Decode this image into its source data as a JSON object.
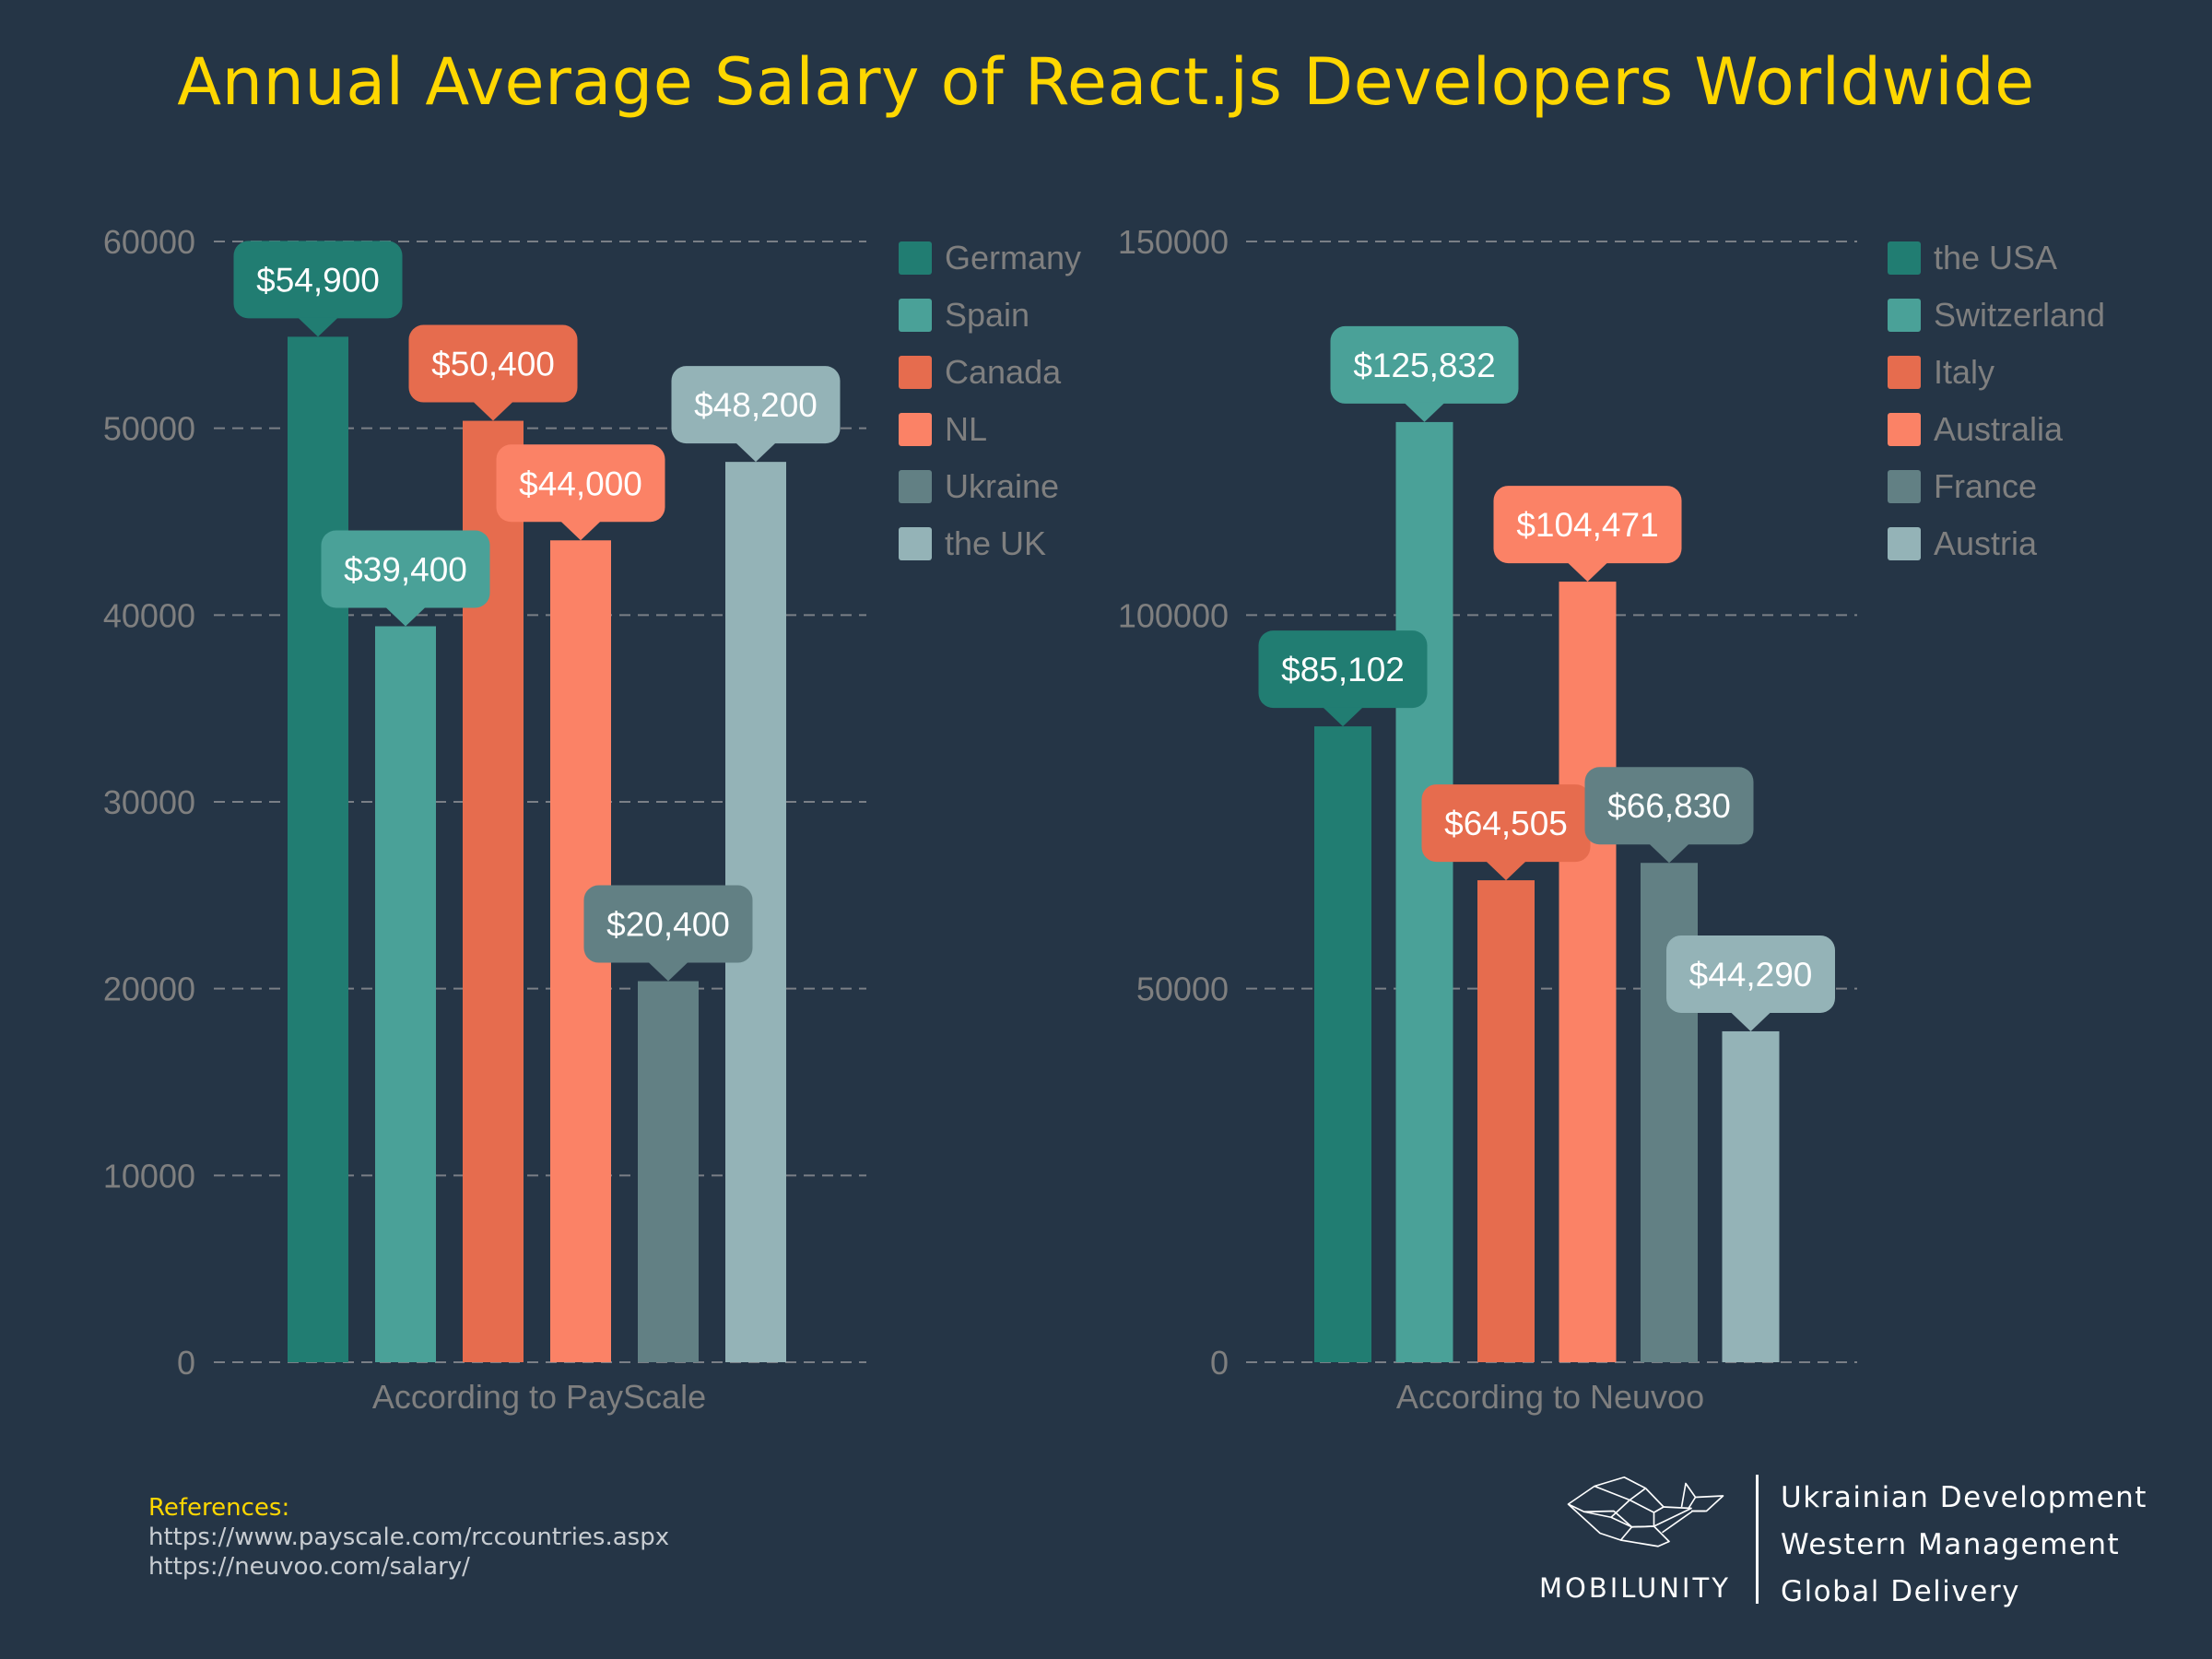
{
  "title": "Annual Average Salary of React.js Developers Worldwide",
  "colors": {
    "background": "#253546",
    "title": "#FFD700",
    "series": [
      "#217d72",
      "#4aa198",
      "#e66c4e",
      "#fb8266",
      "#628084",
      "#94b3b7"
    ]
  },
  "chart_data": [
    {
      "type": "bar",
      "title": "",
      "xlabel": "According to PayScale",
      "ylabel": "",
      "ylim": [
        0,
        60000
      ],
      "yticks": [
        "0",
        "10000",
        "20000",
        "30000",
        "40000",
        "50000",
        "60000"
      ],
      "grid": true,
      "legend_position": "right",
      "categories": [
        "Germany",
        "Spain",
        "Canada",
        "NL",
        "Ukraine",
        "the UK"
      ],
      "values": [
        54900,
        39400,
        50400,
        44000,
        20400,
        48200
      ],
      "data_labels": [
        "$54,900",
        "$39,400",
        "$50,400",
        "$44,000",
        "$20,400",
        "$48,200"
      ]
    },
    {
      "type": "bar",
      "title": "",
      "xlabel": "According to Neuvoo",
      "ylabel": "",
      "ylim": [
        0,
        150000
      ],
      "yticks": [
        "0",
        "50000",
        "100000",
        "150000"
      ],
      "grid": true,
      "legend_position": "right",
      "categories": [
        "the USA",
        "Switzerland",
        "Italy",
        "Australia",
        "France",
        "Austria"
      ],
      "values": [
        85102,
        125832,
        64505,
        104471,
        66830,
        44290
      ],
      "data_labels": [
        "$85,102",
        "$125,832",
        "$64,505",
        "$104,471",
        "$66,830",
        "$44,290"
      ]
    }
  ],
  "references": {
    "heading": "References:",
    "links": [
      "https://www.payscale.com/rccountries.aspx",
      "https://neuvoo.com/salary/"
    ]
  },
  "brand": {
    "name": "MOBILUNITY",
    "taglines": [
      "Ukrainian Development",
      "Western Management",
      "Global Delivery"
    ]
  }
}
